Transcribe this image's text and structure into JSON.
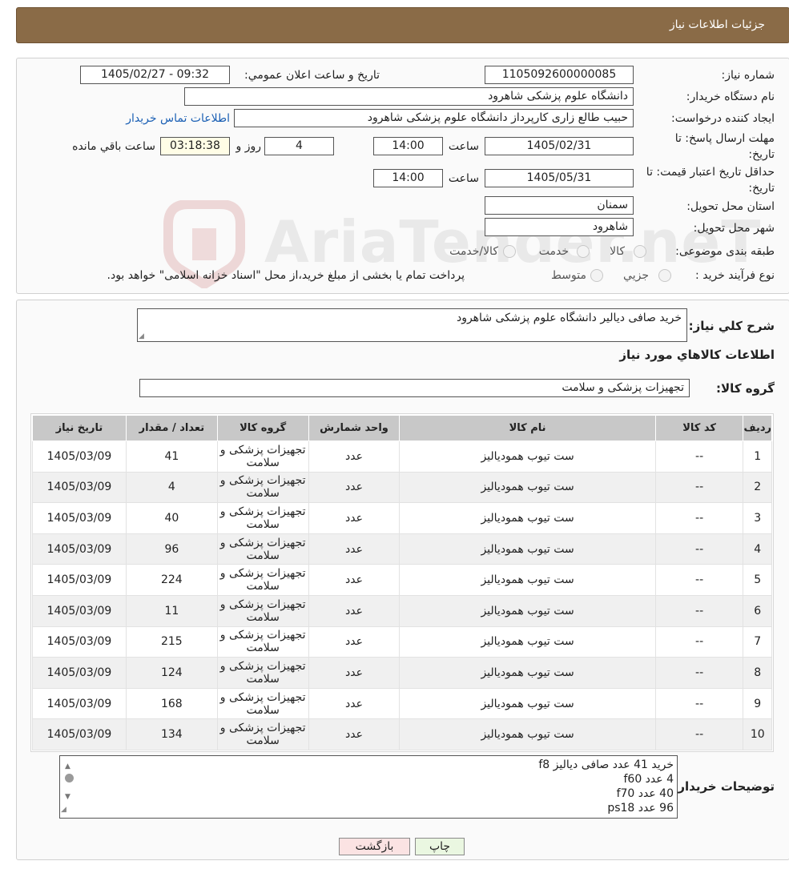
{
  "header": {
    "title": "جزئیات اطلاعات نیاز"
  },
  "watermark": {
    "text": "AriaTender.neT"
  },
  "form": {
    "need_number_label": "شماره نیاز:",
    "need_number": "1105092600000085",
    "announce_label": "تاریخ و ساعت اعلان عمومي:",
    "announce_value": "1405/02/27 - 09:32",
    "buyer_org_label": "نام دستگاه خريدار:",
    "buyer_org": "دانشگاه علوم پزشکی شاهرود",
    "creator_label": "ايجاد کننده درخواست:",
    "creator": "حبیب طالع زاری کارپرداز دانشگاه علوم پزشکی شاهرود",
    "contact_link": "اطلاعات تماس خريدار",
    "deadline_label_1": "مهلت ارسال پاسخ: تا",
    "deadline_label_2": "تاريخ:",
    "deadline_date": "1405/02/31",
    "time_label": "ساعت",
    "deadline_time": "14:00",
    "days_value": "4",
    "days_label": "روز و",
    "remaining_time": "03:18:38",
    "remaining_label": "ساعت باقي مانده",
    "validity_label_1": "حداقل تاريخ اعتبار قيمت: تا",
    "validity_label_2": "تاريخ:",
    "validity_date": "1405/05/31",
    "validity_time": "14:00",
    "province_label": "استان محل تحويل:",
    "province": "سمنان",
    "city_label": "شهر محل تحويل:",
    "city": "شاهرود",
    "category_label": "طبقه بندی موضوعی:",
    "category_options": [
      "کالا",
      "خدمت",
      "کالا/خدمت"
    ],
    "process_label": "نوع فرآيند خريد :",
    "process_options": [
      "جزيي",
      "متوسط"
    ],
    "process_note": "پرداخت تمام يا بخشی از مبلغ خريد،از محل \"اسناد خزانه اسلامی\" خواهد بود."
  },
  "summary": {
    "label": "شرح کلي نياز:",
    "value": "خريد صافی دیالیر دانشگاه علوم پزشکی شاهرود",
    "items_title": "اطلاعات کالاهاي مورد نياز",
    "group_label": "گروه کالا:",
    "group_value": "تجهيزات پزشکی و سلامت"
  },
  "table": {
    "headers": [
      "رديف",
      "کد کالا",
      "نام کالا",
      "واحد شمارش",
      "گروه کالا",
      "تعداد / مقدار",
      "تاريخ نياز"
    ],
    "rows": [
      [
        "1",
        "--",
        "ست تیوب همودیالیز",
        "عدد",
        "تجهيزات پزشکی و سلامت",
        "41",
        "1405/03/09"
      ],
      [
        "2",
        "--",
        "ست تیوب همودیالیز",
        "عدد",
        "تجهيزات پزشکی و سلامت",
        "4",
        "1405/03/09"
      ],
      [
        "3",
        "--",
        "ست تیوب همودیالیز",
        "عدد",
        "تجهيزات پزشکی و سلامت",
        "40",
        "1405/03/09"
      ],
      [
        "4",
        "--",
        "ست تیوب همودیالیز",
        "عدد",
        "تجهيزات پزشکی و سلامت",
        "96",
        "1405/03/09"
      ],
      [
        "5",
        "--",
        "ست تیوب همودیالیز",
        "عدد",
        "تجهيزات پزشکی و سلامت",
        "224",
        "1405/03/09"
      ],
      [
        "6",
        "--",
        "ست تیوب همودیالیز",
        "عدد",
        "تجهيزات پزشکی و سلامت",
        "11",
        "1405/03/09"
      ],
      [
        "7",
        "--",
        "ست تیوب همودیالیز",
        "عدد",
        "تجهيزات پزشکی و سلامت",
        "215",
        "1405/03/09"
      ],
      [
        "8",
        "--",
        "ست تیوب همودیالیز",
        "عدد",
        "تجهيزات پزشکی و سلامت",
        "124",
        "1405/03/09"
      ],
      [
        "9",
        "--",
        "ست تیوب همودیالیز",
        "عدد",
        "تجهيزات پزشکی و سلامت",
        "168",
        "1405/03/09"
      ],
      [
        "10",
        "--",
        "ست تیوب همودیالیز",
        "عدد",
        "تجهيزات پزشکی و سلامت",
        "134",
        "1405/03/09"
      ]
    ]
  },
  "notes": {
    "label": "توضيحات خريدار:",
    "lines": [
      "خرید 41 عدد صافی دیالیز f8",
      "4 عدد f60",
      "40 عدد f70",
      "96 عدد ps18"
    ]
  },
  "buttons": {
    "print": "چاپ",
    "back": "بازگشت"
  }
}
